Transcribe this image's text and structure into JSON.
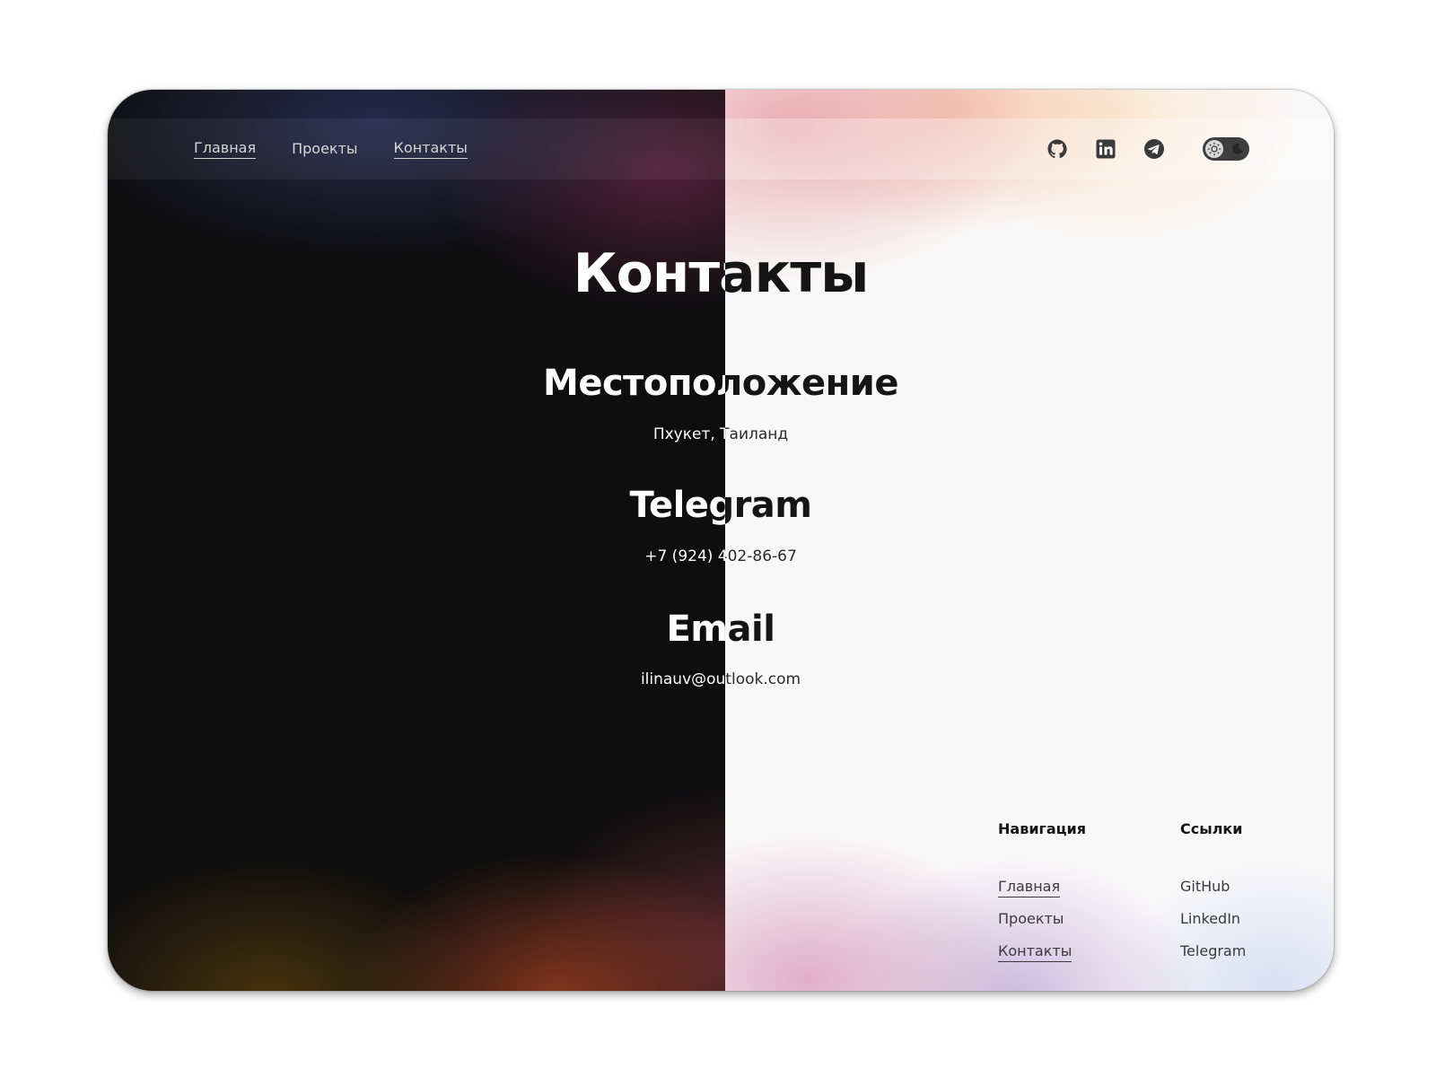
{
  "nav": {
    "links": [
      {
        "label": "Главная"
      },
      {
        "label": "Проекты"
      },
      {
        "label": "Контакты"
      }
    ],
    "icons": [
      "github-icon",
      "linkedin-icon",
      "telegram-icon"
    ],
    "theme_toggle": {
      "icons": [
        "sun-icon",
        "moon-icon"
      ]
    }
  },
  "page": {
    "title": "Контакты",
    "sections": [
      {
        "heading": "Местоположение",
        "value": "Пхукет, Таиланд"
      },
      {
        "heading": "Telegram",
        "value": "+7 (924) 402-86-67"
      },
      {
        "heading": "Email",
        "value": "ilinauv@outlook.com"
      }
    ]
  },
  "footer": {
    "navigation": {
      "heading": "Навигация",
      "items": [
        "Главная",
        "Проекты",
        "Контакты"
      ]
    },
    "links": {
      "heading": "Ссылки",
      "items": [
        "GitHub",
        "LinkedIn",
        "Telegram"
      ]
    }
  },
  "colors": {
    "dark_background": "#0e0e0f",
    "light_background": "#f9f8f8",
    "toggle_track": "#3e3e3e"
  }
}
